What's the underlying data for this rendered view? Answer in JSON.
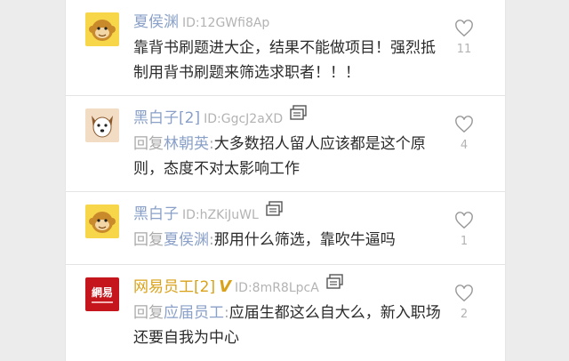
{
  "comments": [
    {
      "user": "夏侯渊",
      "uid": "ID:12GWfi8Ap",
      "text": "靠背书刷题进大企，结果不能做项目！强烈抵制用背书刷题来筛选求职者！！！",
      "likes": "11",
      "avatar_icon": "monkey-avatar-icon"
    },
    {
      "user": "黑白子[2]",
      "uid": "ID:GgcJ2aXD",
      "reply_prefix": "回复",
      "reply_to": "林朝英",
      "text": "大多数招人留人应该都是这个原则，态度不对太影响工作",
      "likes": "4",
      "avatar_icon": "dog-avatar-icon"
    },
    {
      "user": "黑白子",
      "uid": "ID:hZKiJuWL",
      "reply_prefix": "回复",
      "reply_to": "夏侯渊",
      "text": "那用什么筛选，靠吹牛逼吗",
      "likes": "1",
      "avatar_icon": "monkey-avatar-icon"
    },
    {
      "user": "网易员工[2]",
      "verified": "V",
      "uid": "ID:8mR8LpcA",
      "reply_prefix": "回复",
      "reply_to": "应届员工",
      "text": "应届生都这么自大么，新入职场还要自我为中心",
      "likes": "2",
      "avatar_text": "網易",
      "avatar_icon": "netease-logo-avatar-icon"
    }
  ],
  "colors": {
    "username": "#8aa0c8",
    "verified_username": "#d9a21a",
    "id_text": "#b3b3b3",
    "body_text": "#2b2b2b",
    "netease_red": "#c4161c",
    "avatar_yellow": "#f7d64a"
  }
}
